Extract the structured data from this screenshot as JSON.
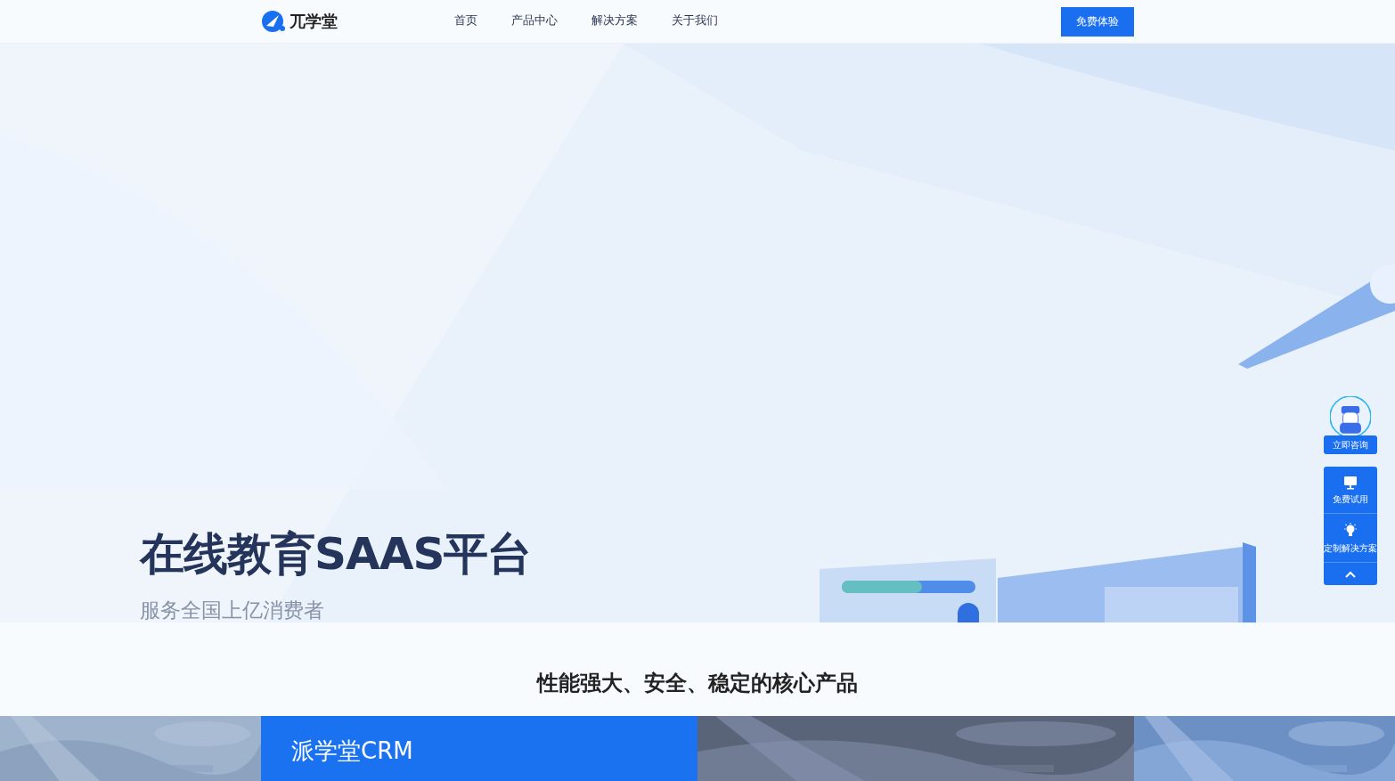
{
  "header": {
    "logo_text": "兀学堂",
    "nav": [
      {
        "label": "首页",
        "selected": false
      },
      {
        "label": "产品中心",
        "selected": false
      },
      {
        "label": "解决方案",
        "selected": false
      },
      {
        "label": "关于我们",
        "selected": false
      }
    ],
    "cta": "免费体验"
  },
  "hero": {
    "title": "在线教育SAAS平台",
    "subtitle": "服务全国上亿消费者"
  },
  "section": {
    "title": "性能强大、安全、稳定的核心产品"
  },
  "cards": [
    {
      "kind": "picture"
    },
    {
      "kind": "feature",
      "title": "派学堂CRM"
    },
    {
      "kind": "picture"
    },
    {
      "kind": "picture"
    }
  ],
  "side_tools": {
    "consult": "立即咨询",
    "items": [
      {
        "kind": "monitor",
        "label": "免费试用"
      },
      {
        "kind": "bulb",
        "label": "定制解决方案"
      }
    ]
  }
}
